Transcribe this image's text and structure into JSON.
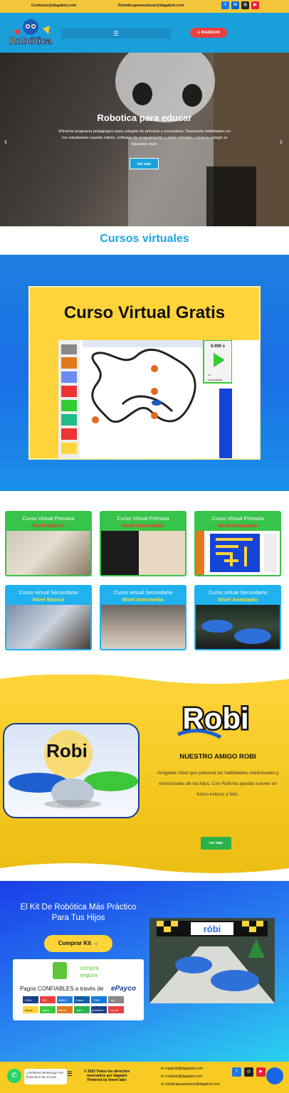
{
  "topbar": {
    "contact": "Contacto@dagabot.com",
    "email2": "Roboticaparaeducar@dagabot.com",
    "social": [
      {
        "icon": "facebook-icon",
        "glyph": "f",
        "color": "#1877f2"
      },
      {
        "icon": "linkedin-icon",
        "glyph": "in",
        "color": "#0a66c2"
      },
      {
        "icon": "instagram-icon",
        "glyph": "◎",
        "color": "#222"
      },
      {
        "icon": "youtube-icon",
        "glyph": "▶",
        "color": "#e8203a"
      }
    ]
  },
  "header": {
    "logo_text": "Robótica",
    "menu_icon": "☰",
    "login_label": "INGRESAR"
  },
  "hero": {
    "title": "Robotica para educar",
    "text": "Eficiente programa pedagógico para colegios de primaria y secundaria. Desarrolla habilidades en los estudiantes usando robots, software de programación y aulas virtuales. Lleva tu colegio al siguiente nivel.",
    "button": "Ver mas",
    "prev": "‹",
    "next": "›"
  },
  "section": {
    "title": "Cursos virtuales"
  },
  "virtual": {
    "title": "Curso Virtual Gratis",
    "timer": "0.000 s",
    "speed_label": "1x",
    "luminosity": "Luminosidad"
  },
  "cards": [
    {
      "title": "Curso Virtual Primaria",
      "subtitle": "Nivel Basico",
      "bg": "#37c44a",
      "sub_color": "#ff2b2b"
    },
    {
      "title": "Curso Virtual Primaria",
      "subtitle": "Nivel Intermedio",
      "bg": "#37c44a",
      "sub_color": "#ff2b2b"
    },
    {
      "title": "Curso Virtual Primaria",
      "subtitle": "Nivel Avanzado",
      "bg": "#37c44a",
      "sub_color": "#ff2b2b"
    },
    {
      "title": "Curso virtual Secundaria",
      "subtitle": "Nivel Basico",
      "bg": "#1fb2ee",
      "sub_color": "#ffe12b"
    },
    {
      "title": "Curso virtual Secundaria",
      "subtitle": "Nivel Intermedio",
      "bg": "#1fb2ee",
      "sub_color": "#ffe12b"
    },
    {
      "title": "Curso virtual Secundaria",
      "subtitle": "Nivel Avanzado",
      "bg": "#1fb2ee",
      "sub_color": "#ffe12b"
    }
  ],
  "robi": {
    "logo": "Robi",
    "heading": "NUESTRO AMIGO ROBI",
    "text": "Amigable robot que potencia las habilidades intelectuales y emocionales de tus hijos. Con Robi les ayudas a tener un futuro exitoso y feliz.",
    "button": "ver mas"
  },
  "kit": {
    "title": "El Kit De Robótica Más Práctico Para Tus Hijos",
    "button": "Comprar Kit →",
    "secure_badge": "SSL",
    "secure1": "compra",
    "secure2": "segura",
    "pay_text": "Pagos CONFIABLES a través de",
    "pay_brand": "ePayco",
    "methods": [
      "VISA",
      "MC",
      "AMEX",
      "Diners",
      "PSE",
      "eg",
      "efecty",
      "gana",
      "baloto",
      "servi",
      "puntored",
      "su red"
    ],
    "banner": "róbi"
  },
  "footer": {
    "copy": "© 2022 Todos los derechos reservados por dagabot Powered by tinewi labs",
    "emails": [
      "coparobi@dagabot.com",
      "contacto@dagabot.com",
      "roboticaparaeducar@dagabot.com"
    ],
    "wa_text": "¿Prefieres WhatsApp? En línea de 8 am a 6 pm",
    "menu_icon": "☰"
  },
  "colors": {
    "accent_blue": "#199fd9",
    "yellow": "#f7cb24",
    "red": "#e8403e",
    "green": "#2bb34a"
  }
}
